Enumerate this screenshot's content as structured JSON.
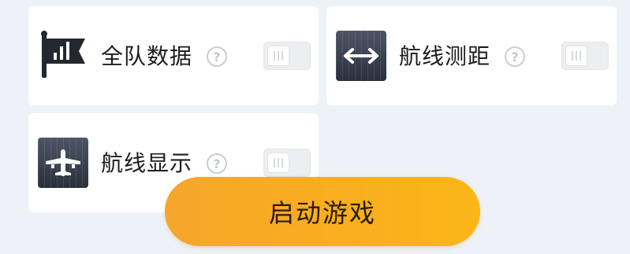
{
  "settings": [
    {
      "label": "全队数据",
      "icon": "flag-bar-chart-icon",
      "help": "?",
      "enabled": false
    },
    {
      "label": "航线测距",
      "icon": "double-arrow-icon",
      "help": "?",
      "enabled": false
    },
    {
      "label": "航线显示",
      "icon": "airplane-icon",
      "help": "?",
      "enabled": false
    }
  ],
  "start_button": {
    "label": "启动游戏"
  },
  "colors": {
    "background": "#eef2f8",
    "card": "#ffffff",
    "button_gradient_start": "#f6a62c",
    "button_gradient_end": "#fbb617",
    "icon_tile": "#3a414e"
  }
}
